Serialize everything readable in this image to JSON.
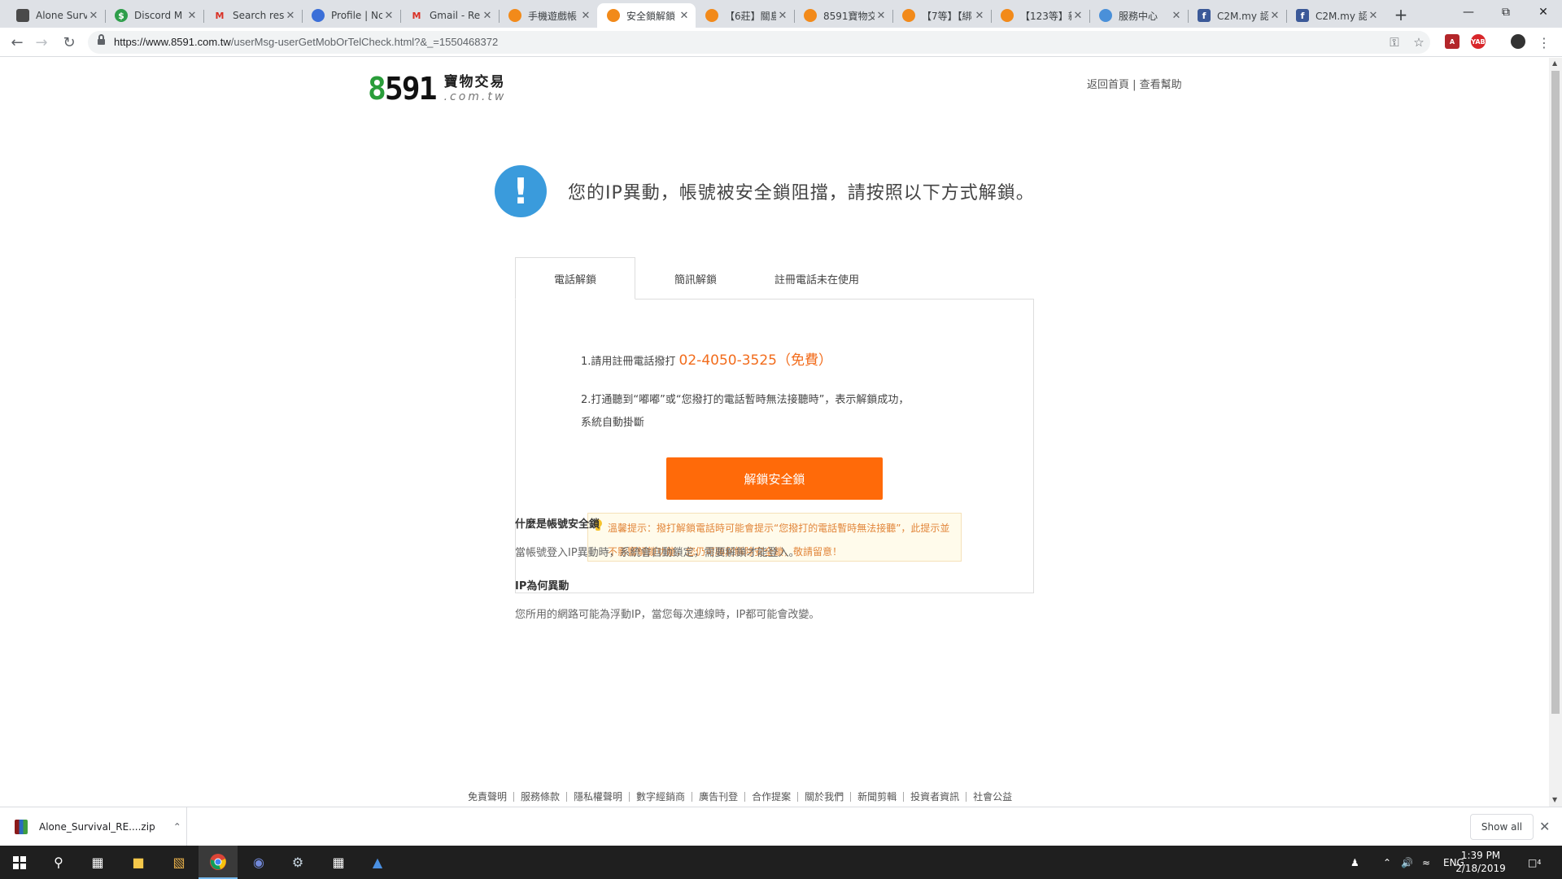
{
  "browser": {
    "tabs": [
      {
        "title": "Alone Survi",
        "icon": "cube-icon",
        "color": "#4a4a4a"
      },
      {
        "title": "Discord M",
        "icon": "dollar-icon",
        "color": "#2e9e4a"
      },
      {
        "title": "Search res",
        "icon": "gmail-icon",
        "color": "#d93025"
      },
      {
        "title": "Profile | Nc",
        "icon": "arch-icon",
        "color": "#3b6fd8"
      },
      {
        "title": "Gmail - Re",
        "icon": "gmail-icon",
        "color": "#d93025"
      },
      {
        "title": "手機遊戲帳",
        "icon": "8591-icon",
        "color": "#f28a1a"
      },
      {
        "title": "安全鎖解鎖",
        "icon": "8591-icon",
        "color": "#f28a1a",
        "active": true
      },
      {
        "title": "【6莊】關島",
        "icon": "8591-icon",
        "color": "#f28a1a"
      },
      {
        "title": "8591寶物交",
        "icon": "8591-icon",
        "color": "#f28a1a"
      },
      {
        "title": "【7等】【綁",
        "icon": "8591-icon",
        "color": "#f28a1a"
      },
      {
        "title": "【123等】新",
        "icon": "8591-icon",
        "color": "#f28a1a"
      },
      {
        "title": "服務中心",
        "icon": "service-icon",
        "color": "#4a90d9"
      },
      {
        "title": "C2M.my 認",
        "icon": "facebook-icon",
        "color": "#3b5998"
      },
      {
        "title": "C2M.my 認",
        "icon": "facebook-icon",
        "color": "#3b5998"
      }
    ],
    "url_host": "https://www.8591.com.tw",
    "url_path": "/userMsg-userGetMobOrTelCheck.html?&_=1550468372"
  },
  "page": {
    "logo_digits": [
      "8",
      "5",
      "9",
      "1"
    ],
    "logo_cn": "寶物交易",
    "logo_en": ".com.tw",
    "link_home": "返回首頁",
    "link_sep": " | ",
    "link_help": "查看幫助",
    "alert_text": "您的IP異動，帳號被安全鎖阻擋，請按照以下方式解鎖。",
    "unlock_tabs": [
      "電話解鎖",
      "簡訊解鎖",
      "註冊電話未在使用"
    ],
    "step1_text": "1.請用註冊電話撥打 ",
    "step1_phone": "02-4050-3525（免費）",
    "step2_text": "2.打通聽到“嘟嘟”或“您撥打的電話暫時無法接聽時”，表示解鎖成功，系統自動掛斷",
    "unlock_button": "解鎖安全鎖",
    "tip_text": "溫馨提示：撥打解鎖電話時可能會提示“您撥打的電話暫時無法接聽”，此提示並不影響解鎖功能，您仍可順利解除安全鎖，敬請留意！",
    "faq": [
      {
        "q": "什麼是帳號安全鎖",
        "a": "當帳號登入IP異動時，系統會自動鎖定，需要解鎖才能登入。"
      },
      {
        "q": "IP為何異動",
        "a": "您所用的網路可能為浮動IP，當您每次連線時，IP都可能會改變。"
      }
    ],
    "footer_links": [
      "免責聲明",
      "服務條款",
      "隱私權聲明",
      "數字經銷商",
      "廣告刊登",
      "合作提案",
      "關於我們",
      "新聞剪輯",
      "投資者資訊",
      "社會公益"
    ]
  },
  "download": {
    "filename": "Alone_Survival_RE....zip",
    "show_all": "Show all"
  },
  "taskbar": {
    "lang": "ENG",
    "time": "1:39 PM",
    "date": "2/18/2019",
    "notif_count": "4"
  }
}
